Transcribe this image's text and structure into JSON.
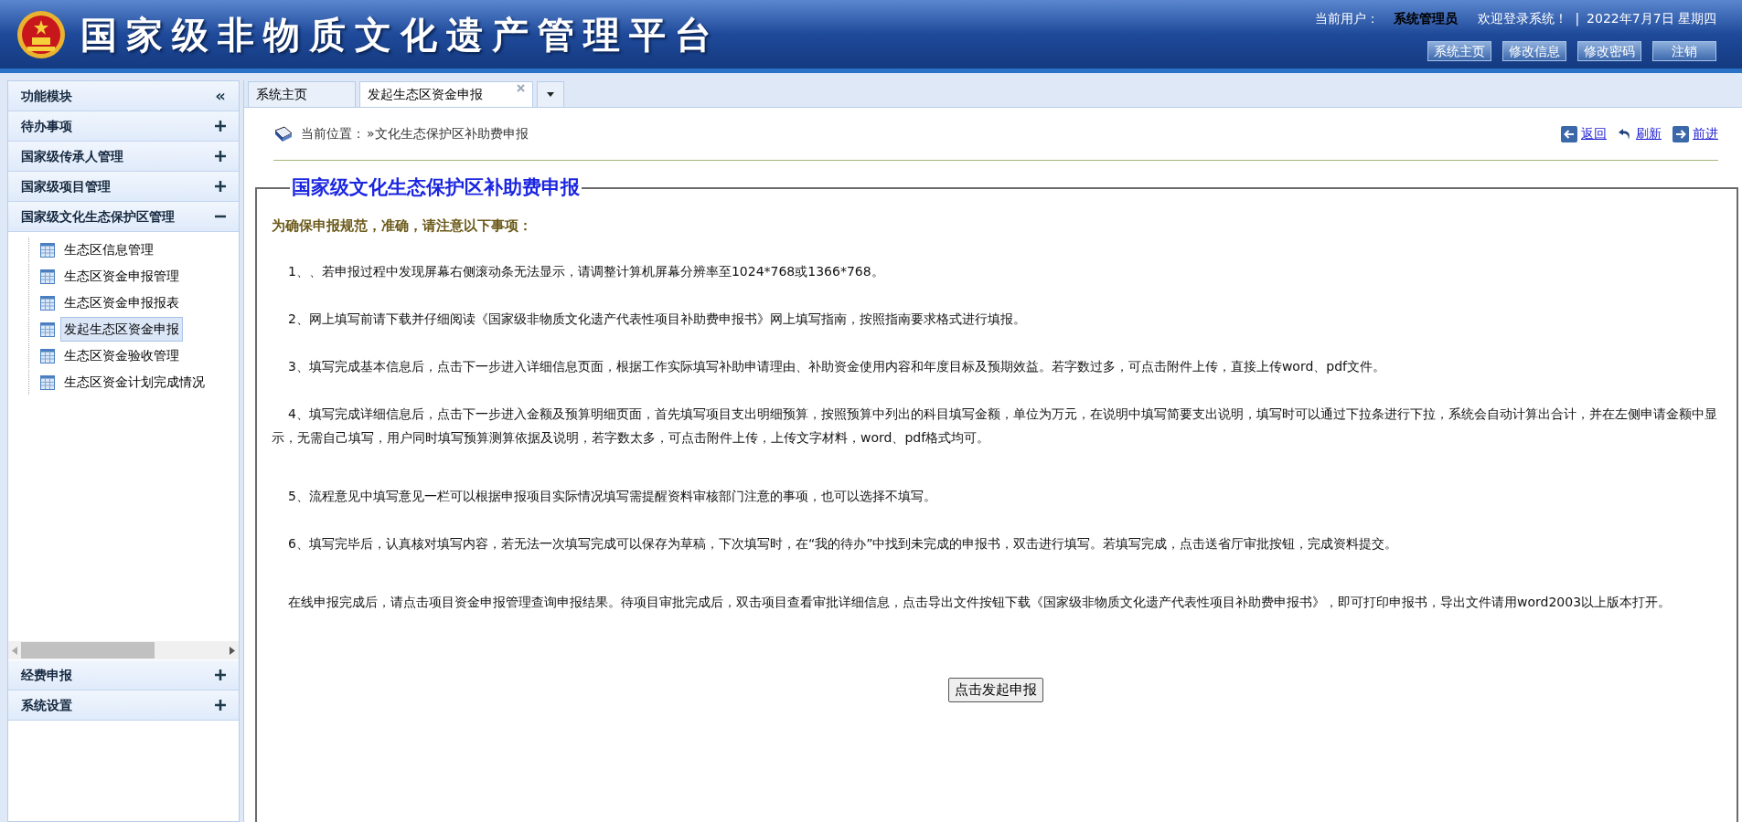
{
  "header": {
    "title": "国家级非物质文化遗产管理平台",
    "user_label": "当前用户：",
    "user_name": "系统管理员",
    "welcome": "欢迎登录系统！",
    "separator": "|",
    "date": "2022年7月7日 星期四",
    "buttons": [
      "系统主页",
      "修改信息",
      "修改密码",
      "注销"
    ]
  },
  "sidebar": {
    "title": "功能模块",
    "collapse": "«",
    "sections": [
      {
        "label": "待办事项",
        "expanded": false
      },
      {
        "label": "国家级传承人管理",
        "expanded": false
      },
      {
        "label": "国家级项目管理",
        "expanded": false
      },
      {
        "label": "国家级文化生态保护区管理",
        "expanded": true,
        "children": [
          {
            "label": "生态区信息管理",
            "selected": false
          },
          {
            "label": "生态区资金申报管理",
            "selected": false
          },
          {
            "label": "生态区资金申报报表",
            "selected": false
          },
          {
            "label": "发起生态区资金申报",
            "selected": true
          },
          {
            "label": "生态区资金验收管理",
            "selected": false
          },
          {
            "label": "生态区资金计划完成情况",
            "selected": false
          }
        ]
      },
      {
        "label": "经费申报",
        "expanded": false
      },
      {
        "label": "系统设置",
        "expanded": false
      }
    ]
  },
  "tabs": [
    {
      "label": "系统主页",
      "selected": false,
      "closable": false
    },
    {
      "label": "发起生态区资金申报",
      "selected": true,
      "closable": true
    }
  ],
  "breadcrumb": {
    "label": "当前位置：",
    "path": "»文化生态保护区补助费申报"
  },
  "nav_links": [
    {
      "kind": "back",
      "label": "返回"
    },
    {
      "kind": "refresh",
      "label": "刷新"
    },
    {
      "kind": "forward",
      "label": "前进"
    }
  ],
  "form": {
    "legend": "国家级文化生态保护区补助费申报",
    "notice": "为确保申报规范，准确，请注意以下事项：",
    "items": [
      "1、、若申报过程中发现屏幕右侧滚动条无法显示，请调整计算机屏幕分辨率至1024*768或1366*768。",
      "2、网上填写前请下载并仔细阅读《国家级非物质文化遗产代表性项目补助费申报书》网上填写指南，按照指南要求格式进行填报。",
      "3、填写完成基本信息后，点击下一步进入详细信息页面，根据工作实际填写补助申请理由、补助资金使用内容和年度目标及预期效益。若字数过多，可点击附件上传，直接上传word、pdf文件。",
      "4、填写完成详细信息后，点击下一步进入金额及预算明细页面，首先填写项目支出明细预算，按照预算中列出的科目填写金额，单位为万元，在说明中填写简要支出说明，填写时可以通过下拉条进行下拉，系统会自动计算出合计，并在左侧申请金额中显示，无需自己填写，用户同时填写预算测算依据及说明，若字数太多，可点击附件上传，上传文字材料，word、pdf格式均可。",
      "5、流程意见中填写意见一栏可以根据申报项目实际情况填写需提醒资料审核部门注意的事项，也可以选择不填写。",
      "6、填写完毕后，认真核对填写内容，若无法一次填写完成可以保存为草稿，下次填写时，在“我的待办”中找到未完成的申报书，双击进行填写。若填写完成，点击送省厅审批按钮，完成资料提交。"
    ],
    "footer": "在线申报完成后，请点击项目资金申报管理查询申报结果。待项目审批完成后，双击项目查看审批详细信息，点击导出文件按钮下载《国家级非物质文化遗产代表性项目补助费申报书》，即可打印申报书，导出文件请用word2003以上版本打开。",
    "submit": "点击发起申报"
  }
}
